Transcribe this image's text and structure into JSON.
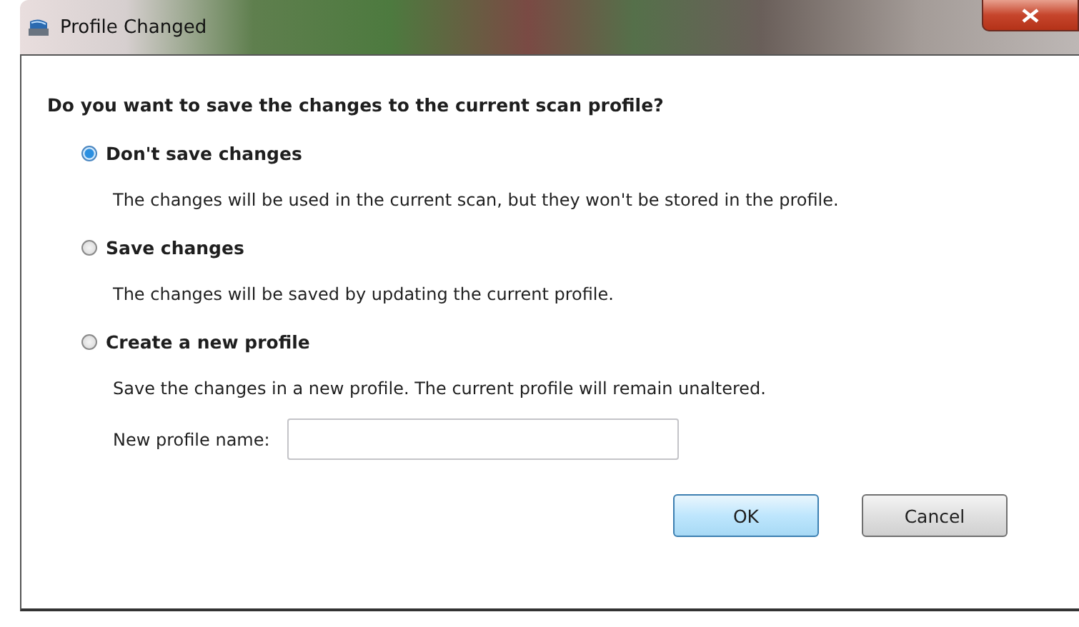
{
  "window": {
    "title": "Profile Changed"
  },
  "question": "Do you want to save the changes to the current scan profile?",
  "options": [
    {
      "label": "Don't save changes",
      "description": "The changes will be used in the current scan, but they won't be stored in the profile.",
      "selected": true
    },
    {
      "label": "Save changes",
      "description": "The changes will be saved by updating the current profile.",
      "selected": false
    },
    {
      "label": "Create a new profile",
      "description": "Save the changes in a new profile. The current profile will remain unaltered.",
      "selected": false
    }
  ],
  "name_field": {
    "label": "New profile name:"
  },
  "buttons": [
    {
      "label": "OK",
      "default": true
    },
    {
      "label": "Cancel",
      "default": false
    }
  ]
}
